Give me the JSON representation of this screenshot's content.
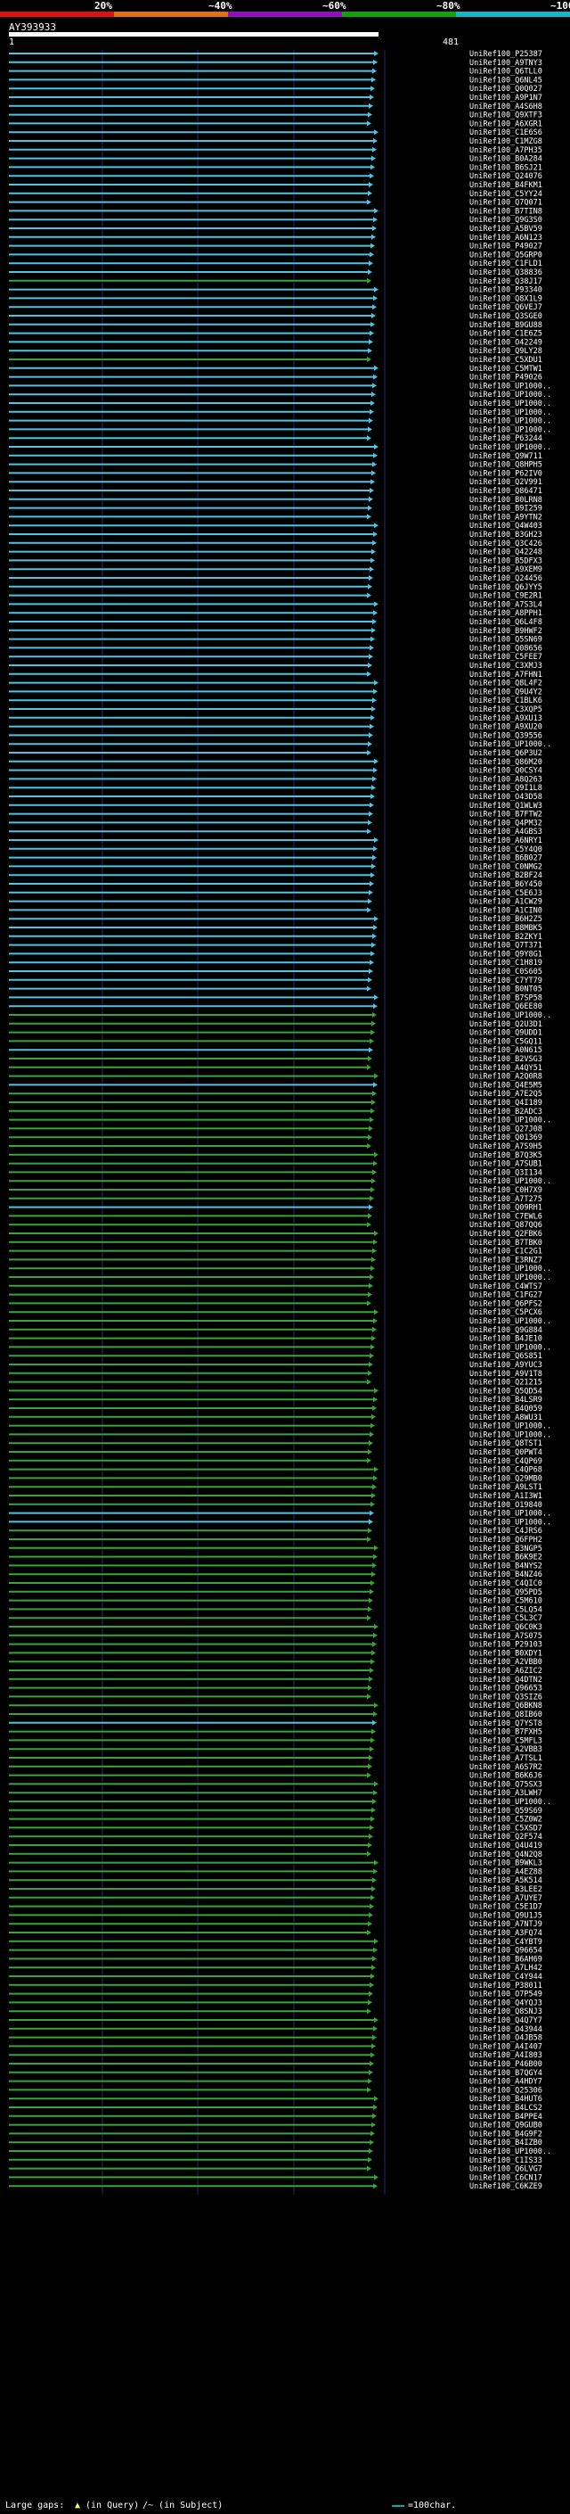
{
  "legend": [
    {
      "label": "20%",
      "color": "#e01010"
    },
    {
      "label": "~40%",
      "color": "#e07010"
    },
    {
      "label": "~60%",
      "color": "#9010c0"
    },
    {
      "label": "~80%",
      "color": "#10a010"
    },
    {
      "label": "~100%",
      "color": "#10b8c8"
    }
  ],
  "query": {
    "name": "AY393933",
    "start": "1",
    "end": "481"
  },
  "colors": {
    "high": "#4fc3e0",
    "mid": "#3aa43a",
    "bg": "#000000",
    "grid": "#2a2a66"
  },
  "hits": [
    {
      "name": "UniRef100_P25387",
      "ident": "high"
    },
    {
      "name": "UniRef100_A9TNY3",
      "ident": "high"
    },
    {
      "name": "UniRef100_Q6TLL0",
      "ident": "high"
    },
    {
      "name": "UniRef100_Q6NL45",
      "ident": "high"
    },
    {
      "name": "UniRef100_Q0Q027",
      "ident": "high"
    },
    {
      "name": "UniRef100_A9P1N7",
      "ident": "high"
    },
    {
      "name": "UniRef100_A4S6H8",
      "ident": "high"
    },
    {
      "name": "UniRef100_Q9XTF3",
      "ident": "high"
    },
    {
      "name": "UniRef100_A6XGR1",
      "ident": "high"
    },
    {
      "name": "UniRef100_C1E6S6",
      "ident": "high"
    },
    {
      "name": "UniRef100_C1MZG8",
      "ident": "high"
    },
    {
      "name": "UniRef100_A7PH35",
      "ident": "high"
    },
    {
      "name": "UniRef100_B0A284",
      "ident": "high"
    },
    {
      "name": "UniRef100_B6SJ21",
      "ident": "high"
    },
    {
      "name": "UniRef100_Q24076",
      "ident": "high"
    },
    {
      "name": "UniRef100_B4FKM1",
      "ident": "high"
    },
    {
      "name": "UniRef100_C5YY24",
      "ident": "high"
    },
    {
      "name": "UniRef100_Q7Q071",
      "ident": "high"
    },
    {
      "name": "UniRef100_B7TIN8",
      "ident": "high"
    },
    {
      "name": "UniRef100_Q9G3S0",
      "ident": "high"
    },
    {
      "name": "UniRef100_A5BV59",
      "ident": "high"
    },
    {
      "name": "UniRef100_A6N123",
      "ident": "high"
    },
    {
      "name": "UniRef100_P49027",
      "ident": "high"
    },
    {
      "name": "UniRef100_Q5GRP0",
      "ident": "high"
    },
    {
      "name": "UniRef100_C1FLD1",
      "ident": "high"
    },
    {
      "name": "UniRef100_Q38836",
      "ident": "high"
    },
    {
      "name": "UniRef100_Q38J17",
      "ident": "mid"
    },
    {
      "name": "UniRef100_P93340",
      "ident": "high"
    },
    {
      "name": "UniRef100_Q8X1L9",
      "ident": "high"
    },
    {
      "name": "UniRef100_Q6VEJ7",
      "ident": "high"
    },
    {
      "name": "UniRef100_Q3SGE0",
      "ident": "high"
    },
    {
      "name": "UniRef100_B9GU88",
      "ident": "high"
    },
    {
      "name": "UniRef100_C1E6Z5",
      "ident": "high"
    },
    {
      "name": "UniRef100_O42249",
      "ident": "high"
    },
    {
      "name": "UniRef100_Q9LY28",
      "ident": "high"
    },
    {
      "name": "UniRef100_C5XDU1",
      "ident": "mid"
    },
    {
      "name": "UniRef100_C5MTW1",
      "ident": "high"
    },
    {
      "name": "UniRef100_P49026",
      "ident": "high"
    },
    {
      "name": "UniRef100_UP1000..",
      "ident": "high"
    },
    {
      "name": "UniRef100_UP1000..",
      "ident": "high"
    },
    {
      "name": "UniRef100_UP1000..",
      "ident": "high"
    },
    {
      "name": "UniRef100_UP1000..",
      "ident": "high"
    },
    {
      "name": "UniRef100_UP1000..",
      "ident": "high"
    },
    {
      "name": "UniRef100_UP1000..",
      "ident": "high"
    },
    {
      "name": "UniRef100_P63244",
      "ident": "high"
    },
    {
      "name": "UniRef100_UP1000..",
      "ident": "high"
    },
    {
      "name": "UniRef100_Q9W711",
      "ident": "high"
    },
    {
      "name": "UniRef100_Q8HPH5",
      "ident": "high"
    },
    {
      "name": "UniRef100_P62IV0",
      "ident": "high"
    },
    {
      "name": "UniRef100_Q2V991",
      "ident": "high"
    },
    {
      "name": "UniRef100_Q86471",
      "ident": "high"
    },
    {
      "name": "UniRef100_B0LRN8",
      "ident": "high"
    },
    {
      "name": "UniRef100_B9I259",
      "ident": "high"
    },
    {
      "name": "UniRef100_A9YTN2",
      "ident": "high"
    },
    {
      "name": "UniRef100_Q4W403",
      "ident": "high"
    },
    {
      "name": "UniRef100_B3GH23",
      "ident": "high"
    },
    {
      "name": "UniRef100_Q3C426",
      "ident": "high"
    },
    {
      "name": "UniRef100_Q42248",
      "ident": "high"
    },
    {
      "name": "UniRef100_B5DFX3",
      "ident": "high"
    },
    {
      "name": "UniRef100_A9XEM9",
      "ident": "high"
    },
    {
      "name": "UniRef100_Q24456",
      "ident": "high"
    },
    {
      "name": "UniRef100_Q6JYY5",
      "ident": "high"
    },
    {
      "name": "UniRef100_C9E2R1",
      "ident": "high"
    },
    {
      "name": "UniRef100_A7S3L4",
      "ident": "high"
    },
    {
      "name": "UniRef100_A8PPH1",
      "ident": "high"
    },
    {
      "name": "UniRef100_Q6L4F8",
      "ident": "high"
    },
    {
      "name": "UniRef100_B9HWF2",
      "ident": "high"
    },
    {
      "name": "UniRef100_Q5SN69",
      "ident": "high"
    },
    {
      "name": "UniRef100_Q08656",
      "ident": "high"
    },
    {
      "name": "UniRef100_C5FEE7",
      "ident": "high"
    },
    {
      "name": "UniRef100_C3XMJ3",
      "ident": "high"
    },
    {
      "name": "UniRef100_A7FHN1",
      "ident": "high"
    },
    {
      "name": "UniRef100_Q8L4F2",
      "ident": "high"
    },
    {
      "name": "UniRef100_Q9U4Y2",
      "ident": "high"
    },
    {
      "name": "UniRef100_C1BLK6",
      "ident": "high"
    },
    {
      "name": "UniRef100_C3XQP5",
      "ident": "high"
    },
    {
      "name": "UniRef100_A9XU13",
      "ident": "high"
    },
    {
      "name": "UniRef100_A9XU20",
      "ident": "high"
    },
    {
      "name": "UniRef100_Q39556",
      "ident": "high"
    },
    {
      "name": "UniRef100_UP1000..",
      "ident": "high"
    },
    {
      "name": "UniRef100_Q6P3U2",
      "ident": "high"
    },
    {
      "name": "UniRef100_Q86M20",
      "ident": "high"
    },
    {
      "name": "UniRef100_Q0CSY4",
      "ident": "high"
    },
    {
      "name": "UniRef100_A8Q263",
      "ident": "high"
    },
    {
      "name": "UniRef100_Q9I1L8",
      "ident": "high"
    },
    {
      "name": "UniRef100_O43D58",
      "ident": "high"
    },
    {
      "name": "UniRef100_Q1WLW3",
      "ident": "high"
    },
    {
      "name": "UniRef100_B7FTW2",
      "ident": "high"
    },
    {
      "name": "UniRef100_Q4PM32",
      "ident": "high"
    },
    {
      "name": "UniRef100_A4GBS3",
      "ident": "high"
    },
    {
      "name": "UniRef100_A6NRY1",
      "ident": "high"
    },
    {
      "name": "UniRef100_C5Y4Q0",
      "ident": "high"
    },
    {
      "name": "UniRef100_B6B027",
      "ident": "high"
    },
    {
      "name": "UniRef100_C0NMG2",
      "ident": "high"
    },
    {
      "name": "UniRef100_B2BF24",
      "ident": "high"
    },
    {
      "name": "UniRef100_B6Y450",
      "ident": "high"
    },
    {
      "name": "UniRef100_C5E6J3",
      "ident": "high"
    },
    {
      "name": "UniRef100_A1CW29",
      "ident": "high"
    },
    {
      "name": "UniRef100_A1CIN0",
      "ident": "high"
    },
    {
      "name": "UniRef100_B6H2Z5",
      "ident": "high"
    },
    {
      "name": "UniRef100_B8MBK5",
      "ident": "high"
    },
    {
      "name": "UniRef100_B2ZKY1",
      "ident": "high"
    },
    {
      "name": "UniRef100_Q7T371",
      "ident": "high"
    },
    {
      "name": "UniRef100_Q9Y8G1",
      "ident": "high"
    },
    {
      "name": "UniRef100_C1H819",
      "ident": "high"
    },
    {
      "name": "UniRef100_C0S605",
      "ident": "high"
    },
    {
      "name": "UniRef100_C7YT79",
      "ident": "high"
    },
    {
      "name": "UniRef100_B0NT05",
      "ident": "high"
    },
    {
      "name": "UniRef100_B7SP58",
      "ident": "high"
    },
    {
      "name": "UniRef100_Q6EE80",
      "ident": "high"
    },
    {
      "name": "UniRef100_UP1000..",
      "ident": "mid"
    },
    {
      "name": "UniRef100_Q2U3D1",
      "ident": "mid"
    },
    {
      "name": "UniRef100_Q9UDD1",
      "ident": "mid"
    },
    {
      "name": "UniRef100_C5GQ11",
      "ident": "mid"
    },
    {
      "name": "UniRef100_A0N615",
      "ident": "high"
    },
    {
      "name": "UniRef100_B2VSG3",
      "ident": "mid"
    },
    {
      "name": "UniRef100_A4QY51",
      "ident": "mid"
    },
    {
      "name": "UniRef100_A2Q0R8",
      "ident": "mid"
    },
    {
      "name": "UniRef100_Q4E5M5",
      "ident": "high"
    },
    {
      "name": "UniRef100_A7E2Q5",
      "ident": "mid"
    },
    {
      "name": "UniRef100_Q4I189",
      "ident": "mid"
    },
    {
      "name": "UniRef100_B2ADC3",
      "ident": "mid"
    },
    {
      "name": "UniRef100_UP1000..",
      "ident": "mid"
    },
    {
      "name": "UniRef100_Q27J08",
      "ident": "mid"
    },
    {
      "name": "UniRef100_Q01369",
      "ident": "mid"
    },
    {
      "name": "UniRef100_A7S9H5",
      "ident": "mid"
    },
    {
      "name": "UniRef100_B7Q3K5",
      "ident": "mid"
    },
    {
      "name": "UniRef100_A7SUB1",
      "ident": "mid"
    },
    {
      "name": "UniRef100_Q3I134",
      "ident": "mid"
    },
    {
      "name": "UniRef100_UP1000..",
      "ident": "mid"
    },
    {
      "name": "UniRef100_C0H7X9",
      "ident": "mid"
    },
    {
      "name": "UniRef100_A7T275",
      "ident": "mid"
    },
    {
      "name": "UniRef100_Q09RH1",
      "ident": "high"
    },
    {
      "name": "UniRef100_C7EWL6",
      "ident": "mid"
    },
    {
      "name": "UniRef100_Q87QQ6",
      "ident": "mid"
    },
    {
      "name": "UniRef100_Q2FBK6",
      "ident": "mid"
    },
    {
      "name": "UniRef100_B7TBK0",
      "ident": "mid"
    },
    {
      "name": "UniRef100_C1C2G1",
      "ident": "mid"
    },
    {
      "name": "UniRef100_E3RNZ7",
      "ident": "mid"
    },
    {
      "name": "UniRef100_UP1000..",
      "ident": "mid"
    },
    {
      "name": "UniRef100_UP1000..",
      "ident": "mid"
    },
    {
      "name": "UniRef100_C4WTS7",
      "ident": "mid"
    },
    {
      "name": "UniRef100_C1FG27",
      "ident": "mid"
    },
    {
      "name": "UniRef100_Q6PFS2",
      "ident": "mid"
    },
    {
      "name": "UniRef100_C5PCX6",
      "ident": "mid"
    },
    {
      "name": "UniRef100_UP1000..",
      "ident": "mid"
    },
    {
      "name": "UniRef100_Q9G884",
      "ident": "mid"
    },
    {
      "name": "UniRef100_B4JE10",
      "ident": "mid"
    },
    {
      "name": "UniRef100_UP1000..",
      "ident": "mid"
    },
    {
      "name": "UniRef100_Q6S851",
      "ident": "mid"
    },
    {
      "name": "UniRef100_A9YUC3",
      "ident": "mid"
    },
    {
      "name": "UniRef100_A9V1T8",
      "ident": "mid"
    },
    {
      "name": "UniRef100_Q21215",
      "ident": "mid"
    },
    {
      "name": "UniRef100_Q5QD54",
      "ident": "mid"
    },
    {
      "name": "UniRef100_B4LSR9",
      "ident": "mid"
    },
    {
      "name": "UniRef100_B4Q059",
      "ident": "mid"
    },
    {
      "name": "UniRef100_A8WU31",
      "ident": "mid"
    },
    {
      "name": "UniRef100_UP1000..",
      "ident": "mid"
    },
    {
      "name": "UniRef100_UP1000..",
      "ident": "mid"
    },
    {
      "name": "UniRef100_Q8TST1",
      "ident": "mid"
    },
    {
      "name": "UniRef100_Q0PWT4",
      "ident": "mid"
    },
    {
      "name": "UniRef100_C4QP69",
      "ident": "mid"
    },
    {
      "name": "UniRef100_C4QP68",
      "ident": "mid"
    },
    {
      "name": "UniRef100_Q29MB0",
      "ident": "mid"
    },
    {
      "name": "UniRef100_A9LST1",
      "ident": "mid"
    },
    {
      "name": "UniRef100_A1I3W1",
      "ident": "mid"
    },
    {
      "name": "UniRef100_O19840",
      "ident": "mid"
    },
    {
      "name": "UniRef100_UP1000..",
      "ident": "high"
    },
    {
      "name": "UniRef100_UP1000..",
      "ident": "high"
    },
    {
      "name": "UniRef100_C4JRS6",
      "ident": "mid"
    },
    {
      "name": "UniRef100_Q6FPH2",
      "ident": "mid"
    },
    {
      "name": "UniRef100_B3NGP5",
      "ident": "mid"
    },
    {
      "name": "UniRef100_B6K9E2",
      "ident": "mid"
    },
    {
      "name": "UniRef100_B4NYS2",
      "ident": "mid"
    },
    {
      "name": "UniRef100_B4NZ46",
      "ident": "mid"
    },
    {
      "name": "UniRef100_C4QIC0",
      "ident": "mid"
    },
    {
      "name": "UniRef100_Q95PD5",
      "ident": "mid"
    },
    {
      "name": "UniRef100_C5M610",
      "ident": "mid"
    },
    {
      "name": "UniRef100_C5LQ54",
      "ident": "mid"
    },
    {
      "name": "UniRef100_C5L3C7",
      "ident": "mid"
    },
    {
      "name": "UniRef100_Q6C0K3",
      "ident": "mid"
    },
    {
      "name": "UniRef100_A7S075",
      "ident": "mid"
    },
    {
      "name": "UniRef100_P29103",
      "ident": "mid"
    },
    {
      "name": "UniRef100_B0XDY1",
      "ident": "mid"
    },
    {
      "name": "UniRef100_A2VBB0",
      "ident": "mid"
    },
    {
      "name": "UniRef100_A6ZIC2",
      "ident": "mid"
    },
    {
      "name": "UniRef100_Q4DTN2",
      "ident": "mid"
    },
    {
      "name": "UniRef100_Q96653",
      "ident": "mid"
    },
    {
      "name": "UniRef100_Q3SIZ6",
      "ident": "mid"
    },
    {
      "name": "UniRef100_Q6BKN8",
      "ident": "mid"
    },
    {
      "name": "UniRef100_Q8IB60",
      "ident": "mid"
    },
    {
      "name": "UniRef100_Q7YST8",
      "ident": "high"
    },
    {
      "name": "UniRef100_B7FXH5",
      "ident": "mid"
    },
    {
      "name": "UniRef100_C5MFL3",
      "ident": "mid"
    },
    {
      "name": "UniRef100_A2VBB3",
      "ident": "mid"
    },
    {
      "name": "UniRef100_A7TSL1",
      "ident": "mid"
    },
    {
      "name": "UniRef100_A6S7R2",
      "ident": "mid"
    },
    {
      "name": "UniRef100_B6K6J6",
      "ident": "mid"
    },
    {
      "name": "UniRef100_Q75SX3",
      "ident": "mid"
    },
    {
      "name": "UniRef100_A3LWH7",
      "ident": "mid"
    },
    {
      "name": "UniRef100_UP1000..",
      "ident": "mid"
    },
    {
      "name": "UniRef100_Q59S69",
      "ident": "mid"
    },
    {
      "name": "UniRef100_C5Z0W2",
      "ident": "mid"
    },
    {
      "name": "UniRef100_C5XSD7",
      "ident": "mid"
    },
    {
      "name": "UniRef100_Q2F574",
      "ident": "mid"
    },
    {
      "name": "UniRef100_Q4U419",
      "ident": "mid"
    },
    {
      "name": "UniRef100_Q4N2Q8",
      "ident": "mid"
    },
    {
      "name": "UniRef100_B9WKL3",
      "ident": "mid"
    },
    {
      "name": "UniRef100_A4EZ88",
      "ident": "mid"
    },
    {
      "name": "UniRef100_A5K514",
      "ident": "mid"
    },
    {
      "name": "UniRef100_B3LEE2",
      "ident": "mid"
    },
    {
      "name": "UniRef100_A7UYE7",
      "ident": "mid"
    },
    {
      "name": "UniRef100_C5E1D7",
      "ident": "mid"
    },
    {
      "name": "UniRef100_Q9U1J5",
      "ident": "mid"
    },
    {
      "name": "UniRef100_A7NTJ9",
      "ident": "mid"
    },
    {
      "name": "UniRef100_A3FQ74",
      "ident": "mid"
    },
    {
      "name": "UniRef100_C4YBT9",
      "ident": "mid"
    },
    {
      "name": "UniRef100_Q96654",
      "ident": "mid"
    },
    {
      "name": "UniRef100_B6AH69",
      "ident": "mid"
    },
    {
      "name": "UniRef100_A7LH42",
      "ident": "mid"
    },
    {
      "name": "UniRef100_C4Y944",
      "ident": "mid"
    },
    {
      "name": "UniRef100_P38011",
      "ident": "mid"
    },
    {
      "name": "UniRef100_O7P549",
      "ident": "mid"
    },
    {
      "name": "UniRef100_Q4YQJ3",
      "ident": "mid"
    },
    {
      "name": "UniRef100_Q8SNJ3",
      "ident": "mid"
    },
    {
      "name": "UniRef100_Q4Q7Y7",
      "ident": "mid"
    },
    {
      "name": "UniRef100_O43944",
      "ident": "mid"
    },
    {
      "name": "UniRef100_O4JB58",
      "ident": "mid"
    },
    {
      "name": "UniRef100_A4I407",
      "ident": "mid"
    },
    {
      "name": "UniRef100_A4I803",
      "ident": "mid"
    },
    {
      "name": "UniRef100_P46B00",
      "ident": "mid"
    },
    {
      "name": "UniRef100_B7QGY4",
      "ident": "mid"
    },
    {
      "name": "UniRef100_A4HDY7",
      "ident": "mid"
    },
    {
      "name": "UniRef100_Q25306",
      "ident": "mid"
    },
    {
      "name": "UniRef100_B4HUT6",
      "ident": "mid"
    },
    {
      "name": "UniRef100_B4LCS2",
      "ident": "mid"
    },
    {
      "name": "UniRef100_B4PPE4",
      "ident": "mid"
    },
    {
      "name": "UniRef100_Q9GUB0",
      "ident": "mid"
    },
    {
      "name": "UniRef100_B4G9F2",
      "ident": "mid"
    },
    {
      "name": "UniRef100_B4IZB0",
      "ident": "mid"
    },
    {
      "name": "UniRef100_UP1000..",
      "ident": "mid"
    },
    {
      "name": "UniRef100_C1IS33",
      "ident": "mid"
    },
    {
      "name": "UniRef100_Q6LVG7",
      "ident": "mid"
    },
    {
      "name": "UniRef100_C6CN17",
      "ident": "mid"
    },
    {
      "name": "UniRef100_C6KZE9",
      "ident": "mid"
    }
  ],
  "footer": {
    "gap_label": "Large gaps: ",
    "gap_query": "(in Query)",
    "gap_subject": "/~ (in Subject)",
    "scale_label": "=100char."
  }
}
